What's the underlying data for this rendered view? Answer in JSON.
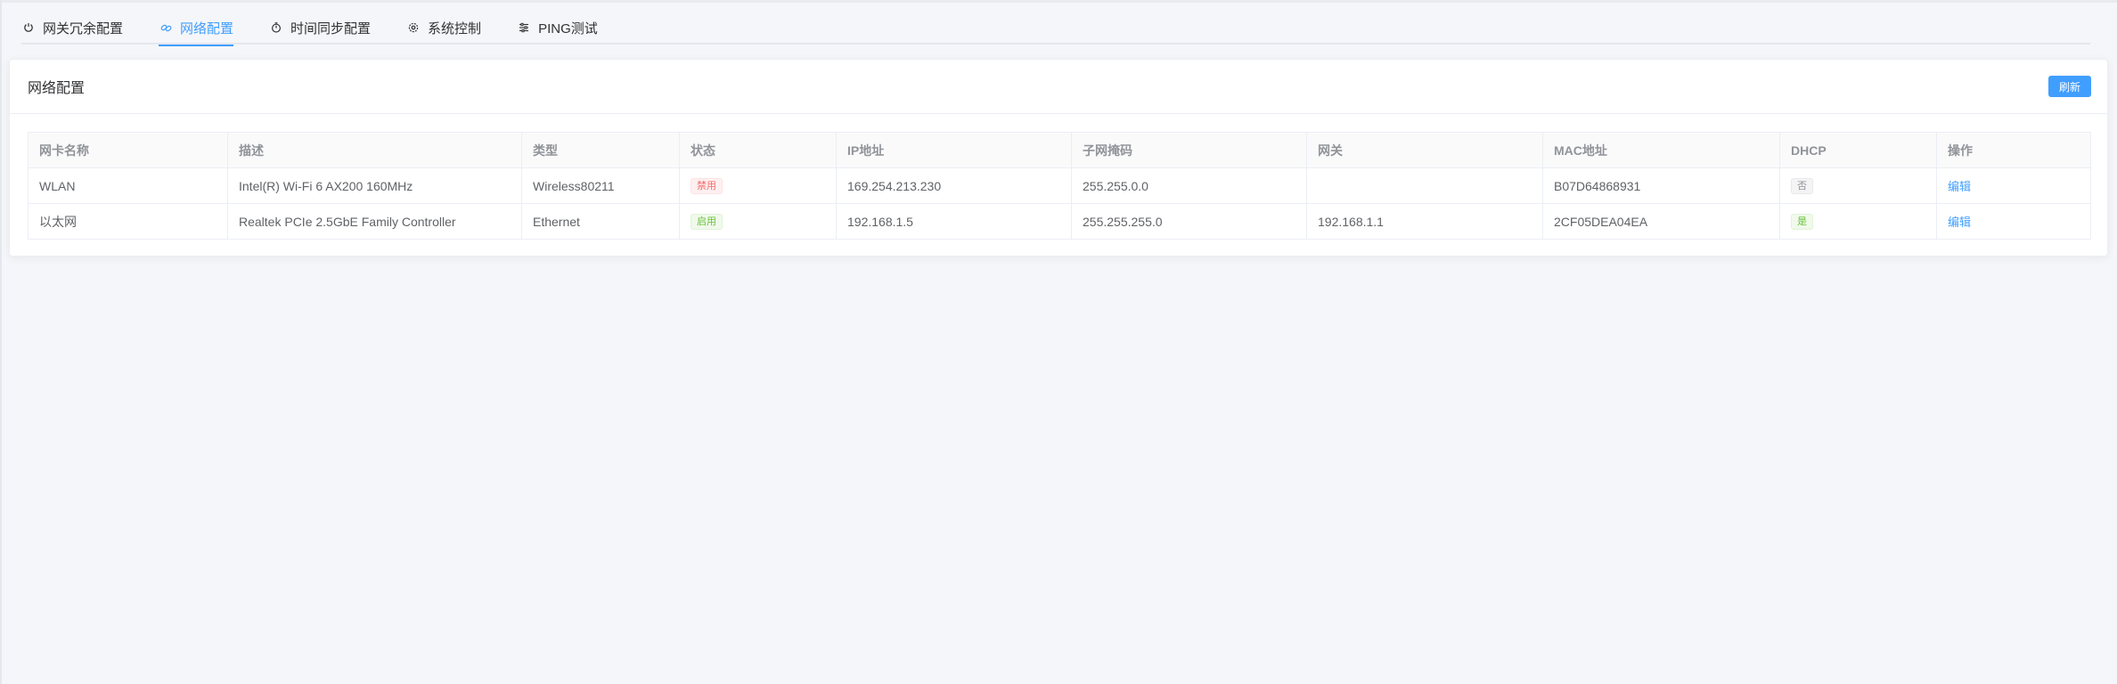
{
  "colors": {
    "primary": "#409eff",
    "danger": "#f56c6c",
    "success": "#67c23a",
    "info": "#909399"
  },
  "tabs": [
    {
      "label": "网关冗余配置",
      "icon": "power-icon",
      "active": false
    },
    {
      "label": "网络配置",
      "icon": "link-icon",
      "active": true
    },
    {
      "label": "时间同步配置",
      "icon": "timer-icon",
      "active": false
    },
    {
      "label": "系统控制",
      "icon": "gear-icon",
      "active": false
    },
    {
      "label": "PING测试",
      "icon": "sliders-icon",
      "active": false
    }
  ],
  "card": {
    "title": "网络配置",
    "refresh_label": "刷新"
  },
  "table": {
    "headers": [
      "网卡名称",
      "描述",
      "类型",
      "状态",
      "IP地址",
      "子网掩码",
      "网关",
      "MAC地址",
      "DHCP",
      "操作"
    ],
    "rows": [
      {
        "name": "WLAN",
        "description": "Intel(R) Wi-Fi 6 AX200 160MHz",
        "type": "Wireless80211",
        "status": "禁用",
        "ip": "169.254.213.230",
        "subnet": "255.255.0.0",
        "gateway": "",
        "mac": "B07D64868931",
        "dhcp": "否",
        "action": "编辑"
      },
      {
        "name": "以太网",
        "description": "Realtek PCIe 2.5GbE Family Controller",
        "type": "Ethernet",
        "status": "启用",
        "ip": "192.168.1.5",
        "subnet": "255.255.255.0",
        "gateway": "192.168.1.1",
        "mac": "2CF05DEA04EA",
        "dhcp": "是",
        "action": "编辑"
      }
    ]
  }
}
